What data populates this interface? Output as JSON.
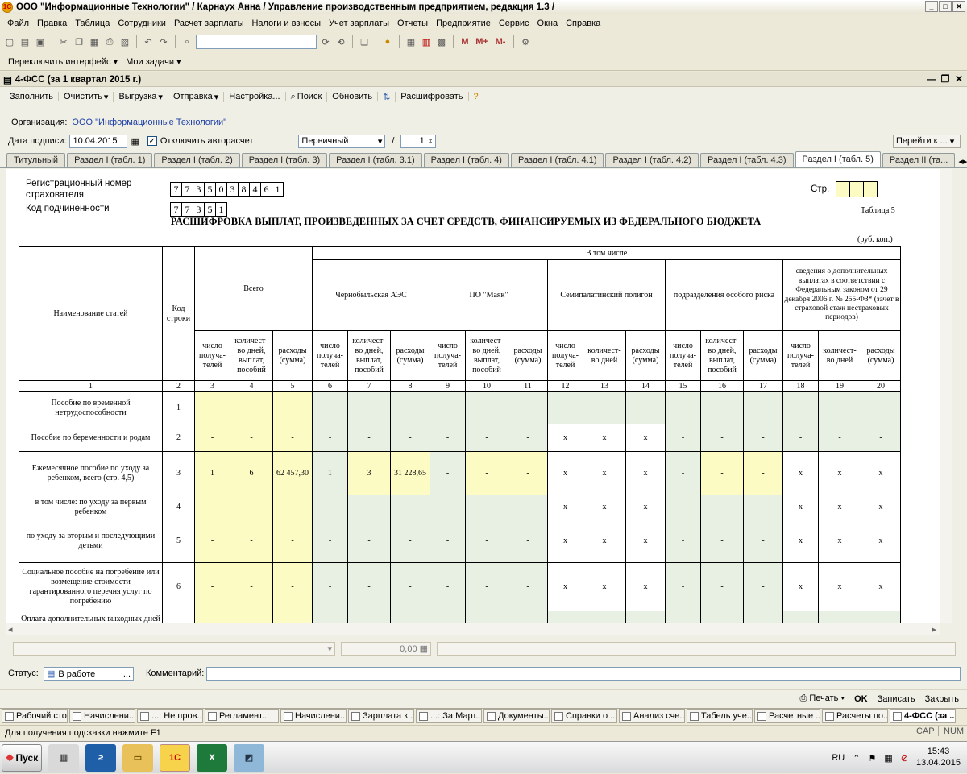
{
  "window": {
    "title": "ООО \"Информационные Технологии\" / Карнаух Анна /  Управление производственным предприятием, редакция 1.3 /"
  },
  "menu": [
    "Файл",
    "Правка",
    "Таблица",
    "Сотрудники",
    "Расчет зарплаты",
    "Налоги и взносы",
    "Учет зарплаты",
    "Отчеты",
    "Предприятие",
    "Сервис",
    "Окна",
    "Справка"
  ],
  "quickbar": {
    "switch_label": "Переключить интерфейс",
    "tasks_label": "Мои задачи"
  },
  "document": {
    "title": "4-ФСС (за 1 квартал 2015 г.)",
    "toolbar": [
      "Заполнить",
      "Очистить",
      "Выгрузка",
      "Отправка",
      "Настройка...",
      "Поиск",
      "Обновить",
      "Расшифровать"
    ],
    "org_label": "Организация:",
    "org_value": "ООО \"Информационные Технологии\"",
    "date_label": "Дата подписи:",
    "date_value": "10.04.2015",
    "autocalc_label": "Отключить авторасчет",
    "type_value": "Первичный",
    "slash": "/",
    "corr_value": "1",
    "goto_label": "Перейти к ...",
    "tabs": [
      "Титульный",
      "Раздел I (табл. 1)",
      "Раздел I (табл. 2)",
      "Раздел I (табл. 3)",
      "Раздел I (табл. 3.1)",
      "Раздел I (табл. 4)",
      "Раздел I (табл. 4.1)",
      "Раздел I (табл. 4.2)",
      "Раздел I (табл. 4.3)",
      "Раздел I (табл. 5)",
      "Раздел II (та..."
    ],
    "active_tab": 9
  },
  "form": {
    "reg_label": "Регистрационный номер страхователя",
    "reg_digits": [
      "7",
      "7",
      "3",
      "5",
      "0",
      "3",
      "8",
      "4",
      "6",
      "1"
    ],
    "sub_label": "Код подчиненности",
    "sub_digits": [
      "7",
      "7",
      "3",
      "5",
      "1"
    ],
    "page_label": "Стр.",
    "table_no": "Таблица 5",
    "heading": "РАСШИФРОВКА ВЫПЛАТ, ПРОИЗВЕДЕННЫХ ЗА СЧЕТ СРЕДСТВ, ФИНАНСИРУЕМЫХ ИЗ  ФЕДЕРАЛЬНОГО БЮДЖЕТА",
    "units": "(руб. коп.)",
    "headers": {
      "name": "Наименование статей",
      "code": "Код строки",
      "total": "Всего",
      "including": "В том числе",
      "chaes": "Чернобыльская АЭС",
      "mayak": "ПО \"Маяк\"",
      "semip": "Семипалатинский полигон",
      "risk": "подразделения особого риска",
      "extra": "сведения о дополнительных выплатах в соответствии с Федеральным законом  от 29 декабря 2006 г. № 255-ФЗ* (зачет в страховой стаж нестраховых периодов)",
      "recipients": "число получа-телей",
      "qty_days_pay": "количест-во дней, выплат, пособий",
      "expenses": "расходы (сумма)",
      "qty_days": "количест-во дней"
    },
    "col_numbers": [
      "1",
      "2",
      "3",
      "4",
      "5",
      "6",
      "7",
      "8",
      "9",
      "10",
      "11",
      "12",
      "13",
      "14",
      "15",
      "16",
      "17",
      "18",
      "19",
      "20"
    ],
    "rows": [
      {
        "name": "Пособие по временной нетрудоспособности",
        "code": "1",
        "cells": [
          "-",
          "-",
          "-",
          "-",
          "-",
          "-",
          "-",
          "-",
          "-",
          "-",
          "-",
          "-",
          "-",
          "-",
          "-",
          "-",
          "-",
          "-"
        ]
      },
      {
        "name": "Пособие по беременности и родам",
        "code": "2",
        "cells": [
          "-",
          "-",
          "-",
          "-",
          "-",
          "-",
          "-",
          "-",
          "-",
          "x",
          "x",
          "x",
          "-",
          "-",
          "-",
          "-",
          "-",
          "-"
        ]
      },
      {
        "name": "Ежемесячное пособие по уходу за ребенком, всего (стр. 4,5)",
        "code": "3",
        "cells": [
          "1",
          "6",
          "62 457,30",
          "1",
          "3",
          "31 228,65",
          "-",
          "-",
          "-",
          "x",
          "x",
          "x",
          "-",
          "-",
          "-",
          "x",
          "x",
          "x"
        ]
      },
      {
        "name": "в том числе: по уходу за первым ребенком",
        "code": "4",
        "cells": [
          "-",
          "-",
          "-",
          "-",
          "-",
          "-",
          "-",
          "-",
          "-",
          "x",
          "x",
          "x",
          "-",
          "-",
          "-",
          "x",
          "x",
          "x"
        ]
      },
      {
        "name": "по уходу за вторым и последующими детьми",
        "code": "5",
        "cells": [
          "-",
          "-",
          "-",
          "-",
          "-",
          "-",
          "-",
          "-",
          "-",
          "x",
          "x",
          "x",
          "-",
          "-",
          "-",
          "x",
          "x",
          "x"
        ]
      },
      {
        "name": "Социальное пособие на погребение или возмещение стоимости гарантированного перечня услуг по погребению",
        "code": "6",
        "cells": [
          "-",
          "-",
          "-",
          "-",
          "-",
          "-",
          "-",
          "-",
          "-",
          "x",
          "x",
          "x",
          "-",
          "-",
          "-",
          "x",
          "x",
          "x"
        ]
      },
      {
        "name": "Оплата дополнительных выходных дней",
        "code": "",
        "cells": [
          "",
          "",
          "",
          "",
          "",
          "",
          "",
          "",
          "",
          "",
          "",
          "",
          "",
          "",
          "",
          "",
          "",
          ""
        ]
      }
    ]
  },
  "sum_value": "0,00",
  "status": {
    "label": "Статус:",
    "value": "В работе",
    "comment_label": "Комментарий:"
  },
  "footer": {
    "print": "Печать",
    "ok": "OK",
    "save": "Записать",
    "close": "Закрыть"
  },
  "open_windows": [
    "Рабочий стол",
    "Начислени...",
    "...: Не пров...",
    "Регламент...",
    "Начислени...",
    "Зарплата к...",
    "...: За Март...",
    "Документы...",
    "Справки о ...",
    "Анализ сче...",
    "Табель уче...",
    "Расчетные ...",
    "Расчеты по...",
    "4-ФСС (за ..."
  ],
  "hint": {
    "text": "Для получения подсказки нажмите F1",
    "cap": "CAP",
    "num": "NUM"
  },
  "taskbar": {
    "start": "Пуск",
    "lang": "RU",
    "time": "15:43",
    "date": "13.04.2015"
  }
}
